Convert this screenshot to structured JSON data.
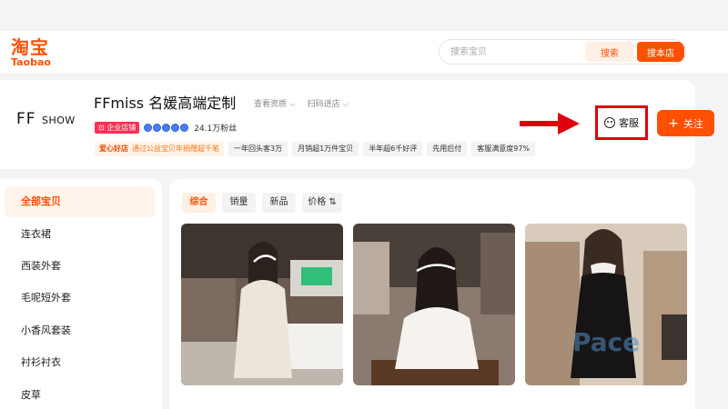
{
  "header": {
    "logo_cn": "淘宝",
    "logo_en": "Taobao",
    "search_placeholder": "搜索宝贝",
    "search_button": "搜索",
    "store_search_button": "搜本店"
  },
  "shop": {
    "logo_big": "FF",
    "logo_small": "SHOW",
    "name": "FFmiss 名媛高端定制",
    "view_qual": "查看资质 ⌵",
    "scan_enter": "扫码进店 ⌵",
    "enterprise_badge": "企业店铺",
    "medal_count": 5,
    "fans": "24.1万粉丝",
    "charity_label": "爱心好店",
    "charity_text": "通过公益宝贝年捐赠超千笔",
    "stats": [
      "一年回头客3万",
      "月销超1万件宝贝",
      "半年超6千好评",
      "先用后付",
      "客服满意度97%"
    ],
    "customer_service": "客服",
    "follow": "关注"
  },
  "sidebar": {
    "items": [
      {
        "label": "全部宝贝",
        "active": true
      },
      {
        "label": "连衣裙",
        "active": false
      },
      {
        "label": "西装外套",
        "active": false
      },
      {
        "label": "毛呢短外套",
        "active": false
      },
      {
        "label": "小香风套装",
        "active": false
      },
      {
        "label": "衬衫衬衣",
        "active": false
      },
      {
        "label": "皮草",
        "active": false
      }
    ]
  },
  "sort_tabs": [
    {
      "label": "综合",
      "active": true
    },
    {
      "label": "销量",
      "active": false
    },
    {
      "label": "新品",
      "active": false
    },
    {
      "label": "价格 ⇅",
      "active": false
    }
  ],
  "colors": {
    "brand": "#ff5000",
    "highlight_border": "#e0000b"
  }
}
